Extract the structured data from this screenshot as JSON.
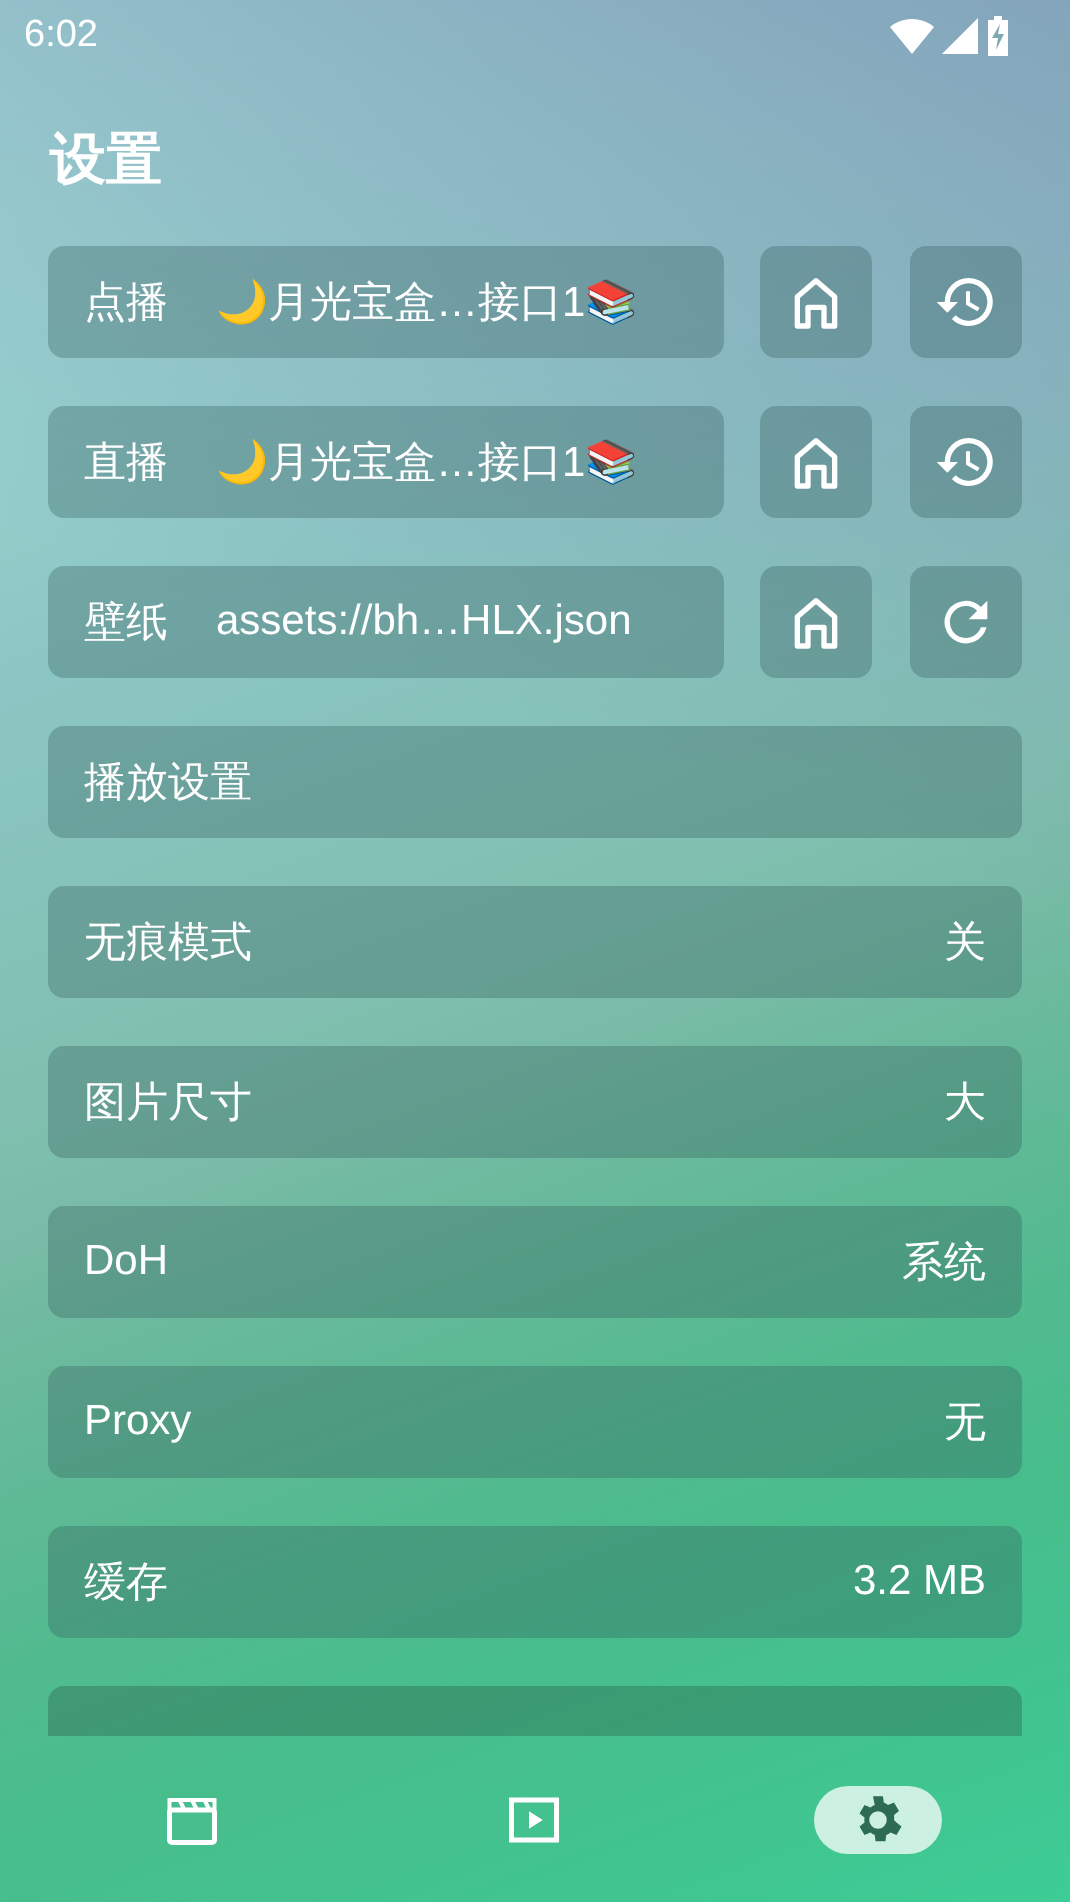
{
  "status_bar": {
    "time": "6:02"
  },
  "title": "设置",
  "rows": [
    {
      "kind": "source",
      "label": "点播",
      "value": "🌙月光宝盒…接口1📚",
      "buttons": [
        {
          "kind": "home"
        },
        {
          "kind": "history"
        }
      ]
    },
    {
      "kind": "source",
      "label": "直播",
      "value": "🌙月光宝盒…接口1📚",
      "buttons": [
        {
          "kind": "home"
        },
        {
          "kind": "history"
        }
      ]
    },
    {
      "kind": "source",
      "label": "壁纸",
      "value": "assets://bh…HLX.json",
      "buttons": [
        {
          "kind": "home"
        },
        {
          "kind": "refresh"
        }
      ]
    },
    {
      "kind": "header",
      "label": "播放设置"
    },
    {
      "kind": "setting",
      "label": "无痕模式",
      "value": "关"
    },
    {
      "kind": "setting",
      "label": "图片尺寸",
      "value": "大"
    },
    {
      "kind": "setting",
      "label": "DoH",
      "value": "系统"
    },
    {
      "kind": "setting",
      "label": "Proxy",
      "value": "无"
    },
    {
      "kind": "setting",
      "label": "缓存",
      "value": "3.2 MB"
    }
  ],
  "nav": [
    {
      "kind": "clapper",
      "selected": false
    },
    {
      "kind": "play",
      "selected": false
    },
    {
      "kind": "settings",
      "selected": true
    }
  ]
}
